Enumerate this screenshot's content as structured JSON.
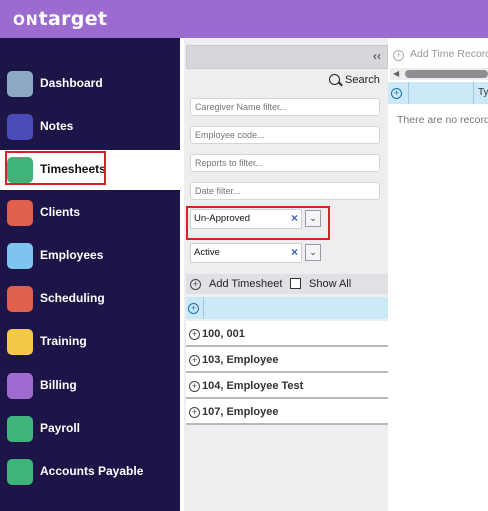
{
  "brand": {
    "prefix": "ON",
    "name": "target"
  },
  "colors": {
    "topbar": "#9b6bd0",
    "sidebar": "#1d1448",
    "highlight": "#d9202a",
    "grid_header": "#cbe9f6"
  },
  "sidebar": {
    "items": [
      {
        "label": "Dashboard",
        "icon": "dashboard-icon",
        "color": "#8fa8c4"
      },
      {
        "label": "Notes",
        "icon": "notes-icon",
        "color": "#4a4ab8"
      },
      {
        "label": "Timesheets",
        "icon": "clock-icon",
        "color": "#3db57a",
        "active": true
      },
      {
        "label": "Clients",
        "icon": "folder-icon",
        "color": "#e0604e"
      },
      {
        "label": "Employees",
        "icon": "folder-icon",
        "color": "#7fc4ef"
      },
      {
        "label": "Scheduling",
        "icon": "calendar-icon",
        "color": "#e0604e"
      },
      {
        "label": "Training",
        "icon": "folder-icon",
        "color": "#f4c94a"
      },
      {
        "label": "Billing",
        "icon": "folder-icon",
        "color": "#a06bd0"
      },
      {
        "label": "Payroll",
        "icon": "folder-icon",
        "color": "#3db57a"
      },
      {
        "label": "Accounts Payable",
        "icon": "folder-icon",
        "color": "#3db57a"
      }
    ]
  },
  "panel": {
    "collapse": "‹‹",
    "search_label": "Search",
    "filters": {
      "caregiver": "Caregiver Name filter...",
      "employee": "Employee code...",
      "reports": "Reports to filter...",
      "date": "Date filter..."
    },
    "approval_select": {
      "value": "Un-Approved",
      "clear": "×",
      "caret": "⌄"
    },
    "status_select": {
      "value": "Active",
      "clear": "×",
      "caret": "⌄"
    },
    "add_timesheet": "Add Timesheet",
    "show_all": "Show All",
    "rows": [
      {
        "label": "100, 001"
      },
      {
        "label": "103, Employee"
      },
      {
        "label": "104, Employee Test"
      },
      {
        "label": "107, Employee"
      }
    ]
  },
  "right": {
    "add_time_record": "Add Time Record",
    "column_type": "Ty",
    "empty_message": "There are no records"
  }
}
